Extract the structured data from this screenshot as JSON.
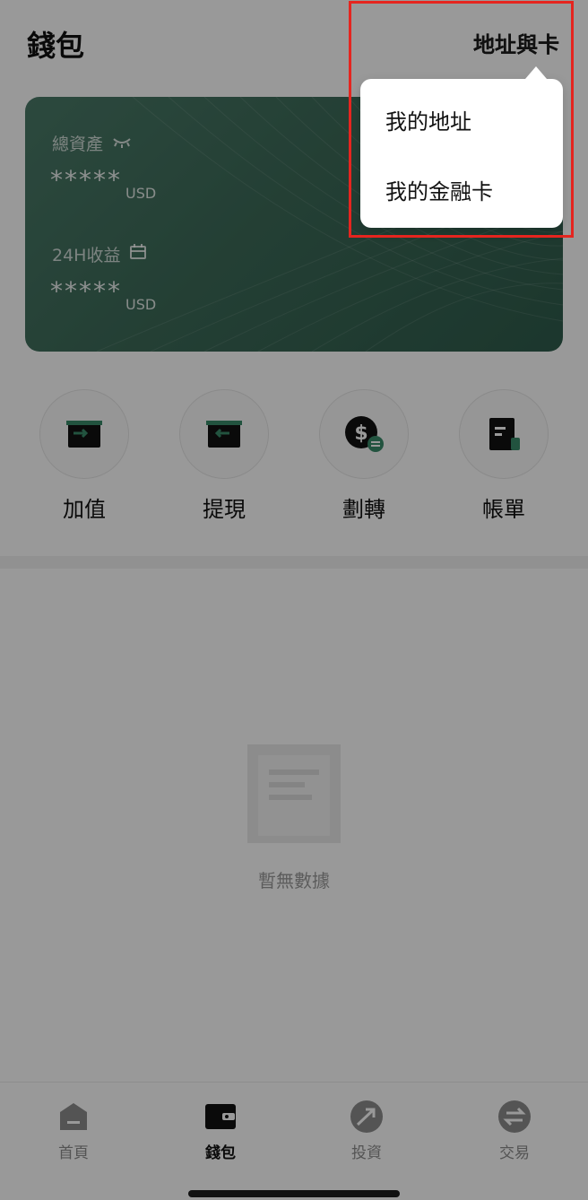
{
  "header": {
    "title": "錢包",
    "action_label": "地址與卡"
  },
  "card": {
    "total_assets_label": "總資產",
    "total_assets_value": "*****",
    "total_assets_unit": "USD",
    "pnl_label": "24H收益",
    "pnl_value": "*****",
    "pnl_unit": "USD"
  },
  "actions": [
    {
      "label": "加值",
      "icon": "deposit-icon"
    },
    {
      "label": "提現",
      "icon": "withdraw-icon"
    },
    {
      "label": "劃轉",
      "icon": "transfer-icon"
    },
    {
      "label": "帳單",
      "icon": "bill-icon"
    }
  ],
  "empty_state": {
    "text": "暫無數據"
  },
  "tabbar": {
    "items": [
      {
        "label": "首頁",
        "icon": "home-icon",
        "active": false
      },
      {
        "label": "錢包",
        "icon": "wallet-icon",
        "active": true
      },
      {
        "label": "投資",
        "icon": "invest-icon",
        "active": false
      },
      {
        "label": "交易",
        "icon": "trade-icon",
        "active": false
      }
    ]
  },
  "dropdown": {
    "items": [
      {
        "label": "我的地址"
      },
      {
        "label": "我的金融卡"
      }
    ]
  },
  "colors": {
    "accent": "#3a8a6a",
    "highlight": "#e5251f",
    "card": "#3c6a58"
  }
}
